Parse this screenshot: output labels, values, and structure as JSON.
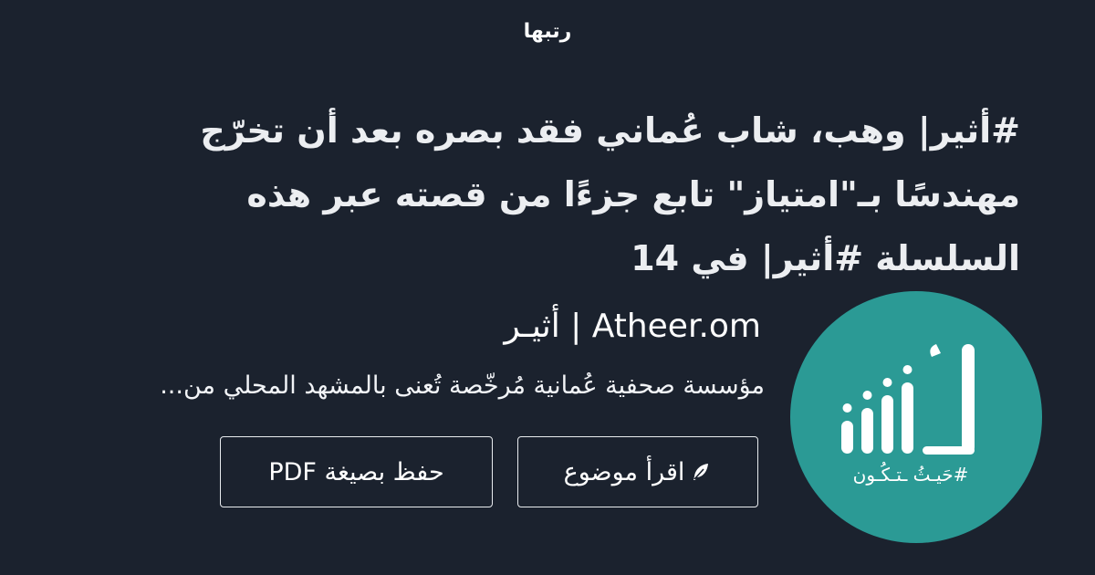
{
  "header": {
    "site_label": "رتبها"
  },
  "article": {
    "title": "#أثير| وهب، شاب عُماني فقد بصره بعد أن تخرّج مهندسًا بـ\"امتياز\" تابع جزءًا من قصته عبر هذه السلسلة #أثير| في 14"
  },
  "brand": {
    "name": "أثيـر | Atheer.om",
    "description": "مؤسسة صحفية عُمانية مُرخّصة تُعنى بالمشهد المحلي من...",
    "logo_text": "#حَيـثُ ـتـكُـون",
    "logo_color": "#2b9a95"
  },
  "actions": {
    "read_label": "اقرأ موضوع",
    "pdf_label": "حفظ بصيغة PDF"
  },
  "icons": {
    "read_icon": "feather-icon"
  }
}
